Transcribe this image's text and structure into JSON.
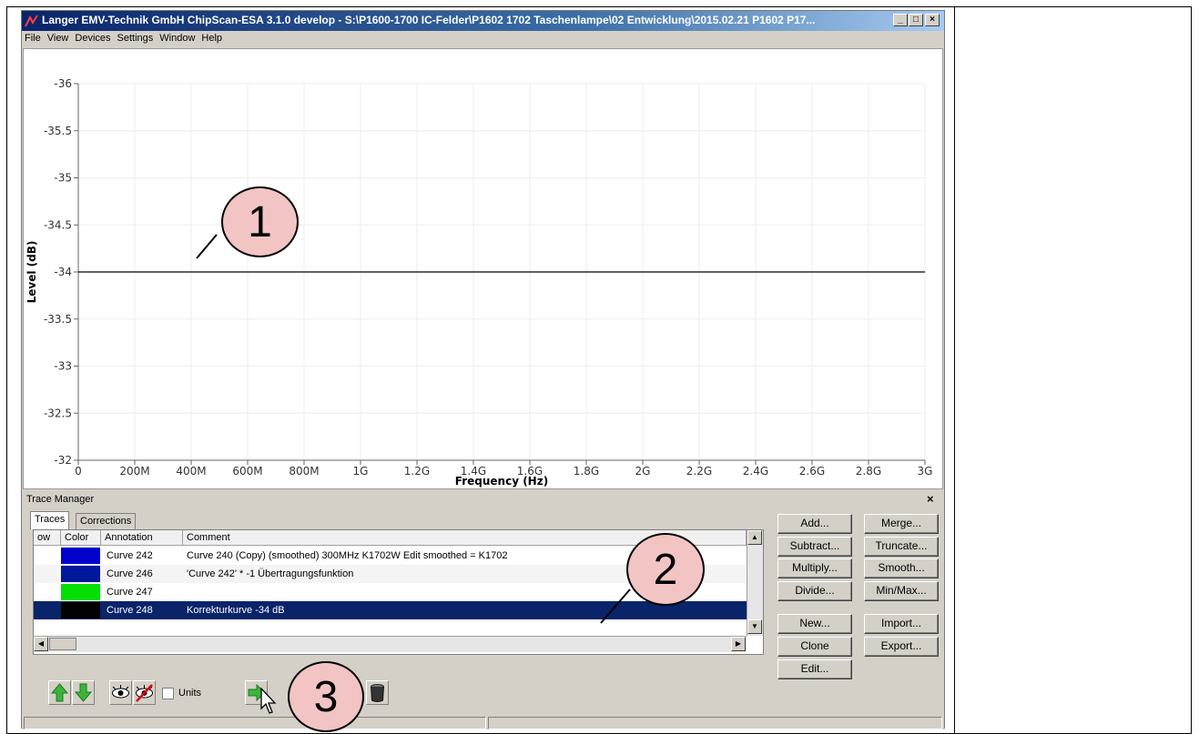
{
  "window": {
    "title": "Langer EMV-Technik GmbH ChipScan-ESA 3.1.0 develop  -  S:\\P1600-1700 IC-Felder\\P1602 1702 Taschenlampe\\02 Entwicklung\\2015.02.21 P1602 P17...",
    "buttons": {
      "minimize": "_",
      "maximize": "□",
      "close": "×"
    }
  },
  "menu": [
    "File",
    "View",
    "Devices",
    "Settings",
    "Window",
    "Help"
  ],
  "chart_data": {
    "type": "line",
    "xlabel": "Frequency (Hz)",
    "ylabel": "Level (dB)",
    "x_ticks": [
      "0",
      "200M",
      "400M",
      "600M",
      "800M",
      "1G",
      "1.2G",
      "1.4G",
      "1.6G",
      "1.8G",
      "2G",
      "2.2G",
      "2.4G",
      "2.6G",
      "2.8G",
      "3G"
    ],
    "y_ticks": [
      "-36",
      "-35.5",
      "-35",
      "-34.5",
      "-34",
      "-33.5",
      "-33",
      "-32.5",
      "-32"
    ],
    "xlim": [
      0,
      3000000000
    ],
    "ylim_display_top_to_bottom": [
      -36,
      -32
    ],
    "grid": true,
    "series": [
      {
        "x": [
          0,
          3000000000
        ],
        "y": [
          -34,
          -34
        ],
        "color": "#000000"
      }
    ]
  },
  "trace_manager": {
    "title": "Trace Manager",
    "close": "×",
    "tabs": [
      "Traces",
      "Corrections"
    ],
    "columns": [
      "ow",
      "Color",
      "Annotation",
      "Comment"
    ],
    "rows": [
      {
        "color": "#0000cc",
        "annotation": "Curve 242",
        "comment": "Curve 240 (Copy) (smoothed) 300MHz  K1702W  Edit smoothed = K1702",
        "selected": false
      },
      {
        "color": "#00189c",
        "annotation": "Curve 246",
        "comment": "'Curve 242' * -1    Übertragungsfunktion",
        "selected": false
      },
      {
        "color": "#00e000",
        "annotation": "Curve 247",
        "comment": "",
        "selected": false
      },
      {
        "color": "#000000",
        "annotation": "Curve 248",
        "comment": "Korrekturkurve -34 dB",
        "selected": true
      }
    ],
    "buttons_col1": [
      "Add...",
      "Subtract...",
      "Multiply...",
      "Divide...",
      "New...",
      "Clone",
      "Edit..."
    ],
    "buttons_col2": [
      "Merge...",
      "Truncate...",
      "Smooth...",
      "Min/Max...",
      "Import...",
      "Export..."
    ],
    "units_label": "Units"
  },
  "callouts": [
    "1",
    "2",
    "3"
  ],
  "colors": {
    "selection": "#0a246a",
    "callout_fill": "#f2c4c4",
    "title_gradient_start": "#0a246a"
  }
}
